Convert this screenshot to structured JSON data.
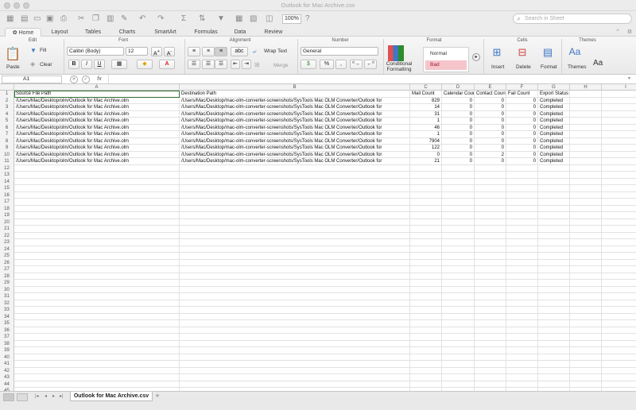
{
  "window": {
    "title": "Outlook for Mac Archive.csv"
  },
  "toolbar": {
    "zoom": "100%",
    "search_placeholder": "Search in Sheet"
  },
  "ribbon_tabs": [
    "Home",
    "Layout",
    "Tables",
    "Charts",
    "SmartArt",
    "Formulas",
    "Data",
    "Review"
  ],
  "ribbon": {
    "groups": {
      "edit": "Edit",
      "font": "Font",
      "alignment": "Alignment",
      "number": "Number",
      "format": "Format",
      "cells": "Cells",
      "themes": "Themes"
    },
    "paste": "Paste",
    "fill": "Fill",
    "clear": "Clear",
    "font_name": "Calibri (Body)",
    "font_size": "12",
    "bold": "B",
    "italic": "I",
    "underline": "U",
    "wrap_text": "Wrap Text",
    "merge": "Merge",
    "abc": "abc",
    "number_format": "General",
    "percent": "%",
    "comma": ",",
    "conditional_formatting": "Conditional Formatting",
    "style_normal": "Normal",
    "style_bad": "Bad",
    "insert": "Insert",
    "delete": "Delete",
    "format_btn": "Format",
    "themes_btn": "Themes",
    "aa": "Aa"
  },
  "formula_bar": {
    "name_box": "A1",
    "fx": "fx",
    "value": ""
  },
  "columns": [
    "A",
    "B",
    "C",
    "D",
    "E",
    "F",
    "G",
    "H",
    "I"
  ],
  "rows": [
    [
      "Source File Path",
      "Destination Path",
      "Mail Count",
      "Calendar Count",
      "Contact Count",
      "Fail Count",
      "Export Status"
    ],
    [
      "/Users/Mac/Desktop/olm/Outlook for Mac Archive.olm",
      "/Users/Mac/Desktop/mac-olm-converter-screenshots/SysTools Mac OLM Converter/Outlook for",
      "829",
      "0",
      "0",
      "0",
      "Completed"
    ],
    [
      "/Users/Mac/Desktop/olm/Outlook for Mac Archive.olm",
      "/Users/Mac/Desktop/mac-olm-converter-screenshots/SysTools Mac OLM Converter/Outlook for",
      "14",
      "0",
      "0",
      "0",
      "Completed"
    ],
    [
      "/Users/Mac/Desktop/olm/Outlook for Mac Archive.olm",
      "/Users/Mac/Desktop/mac-olm-converter-screenshots/SysTools Mac OLM Converter/Outlook for",
      "31",
      "0",
      "0",
      "0",
      "Completed"
    ],
    [
      "/Users/Mac/Desktop/olm/Outlook for Mac Archive.olm",
      "/Users/Mac/Desktop/mac-olm-converter-screenshots/SysTools Mac OLM Converter/Outlook for",
      "1",
      "0",
      "0",
      "0",
      "Completed"
    ],
    [
      "/Users/Mac/Desktop/olm/Outlook for Mac Archive.olm",
      "/Users/Mac/Desktop/mac-olm-converter-screenshots/SysTools Mac OLM Converter/Outlook for",
      "46",
      "0",
      "0",
      "0",
      "Completed"
    ],
    [
      "/Users/Mac/Desktop/olm/Outlook for Mac Archive.olm",
      "/Users/Mac/Desktop/mac-olm-converter-screenshots/SysTools Mac OLM Converter/Outlook for",
      "1",
      "0",
      "0",
      "0",
      "Completed"
    ],
    [
      "/Users/Mac/Desktop/olm/Outlook for Mac Archive.olm",
      "/Users/Mac/Desktop/mac-olm-converter-screenshots/SysTools Mac OLM Converter/Outlook for",
      "7904",
      "0",
      "0",
      "0",
      "Completed"
    ],
    [
      "/Users/Mac/Desktop/olm/Outlook for Mac Archive.olm",
      "/Users/Mac/Desktop/mac-olm-converter-screenshots/SysTools Mac OLM Converter/Outlook for",
      "122",
      "0",
      "0",
      "0",
      "Completed"
    ],
    [
      "/Users/Mac/Desktop/olm/Outlook for Mac Archive.olm",
      "/Users/Mac/Desktop/mac-olm-converter-screenshots/SysTools Mac OLM Converter/Outlook for",
      "0",
      "0",
      "2",
      "0",
      "Completed"
    ],
    [
      "/Users/Mac/Desktop/olm/Outlook for Mac Archive.olm",
      "/Users/Mac/Desktop/mac-olm-converter-screenshots/SysTools Mac OLM Converter/Outlook for",
      "21",
      "0",
      "0",
      "0",
      "Completed"
    ]
  ],
  "row_count": 46,
  "sheet_tab": "Outlook for Mac Archive.csv",
  "add_sheet": "+",
  "colors": {
    "accent": "#2e6e2e",
    "bad_fill": "#f6c5cc"
  }
}
